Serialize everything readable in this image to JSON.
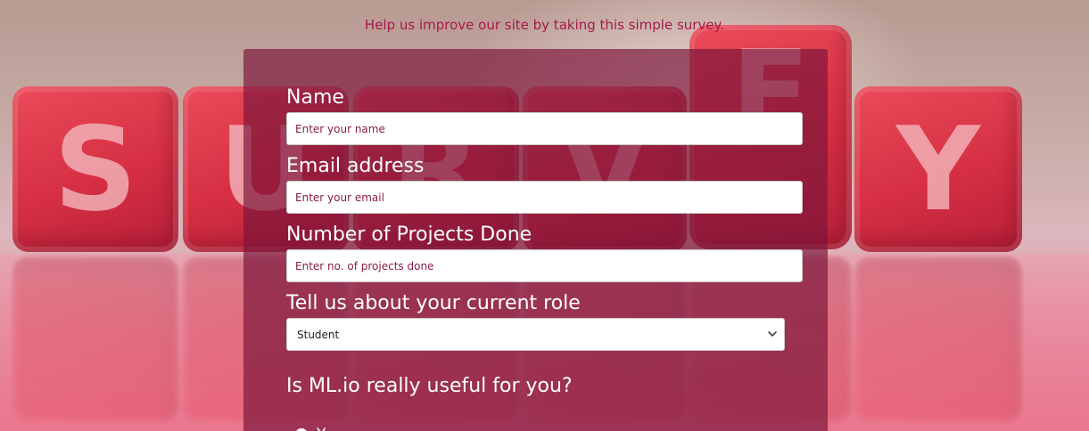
{
  "banner": {
    "text": "Help us improve our site by taking this simple survey."
  },
  "background": {
    "letters": [
      "S",
      "U",
      "R",
      "V",
      "E",
      "Y"
    ]
  },
  "form": {
    "name": {
      "label": "Name",
      "placeholder": "Enter your name"
    },
    "email": {
      "label": "Email address",
      "placeholder": "Enter your email"
    },
    "projects": {
      "label": "Number of Projects Done",
      "placeholder": "Enter no. of projects done"
    },
    "role": {
      "label": "Tell us about your current role",
      "selected": "Student"
    },
    "useful": {
      "question": "Is ML.io really useful for you?",
      "first_option": "Y"
    }
  },
  "colors": {
    "panel": "#7b1539",
    "banner_text": "#a6194a",
    "placeholder_text": "#8a1b4a",
    "label_text": "#ffffff"
  }
}
